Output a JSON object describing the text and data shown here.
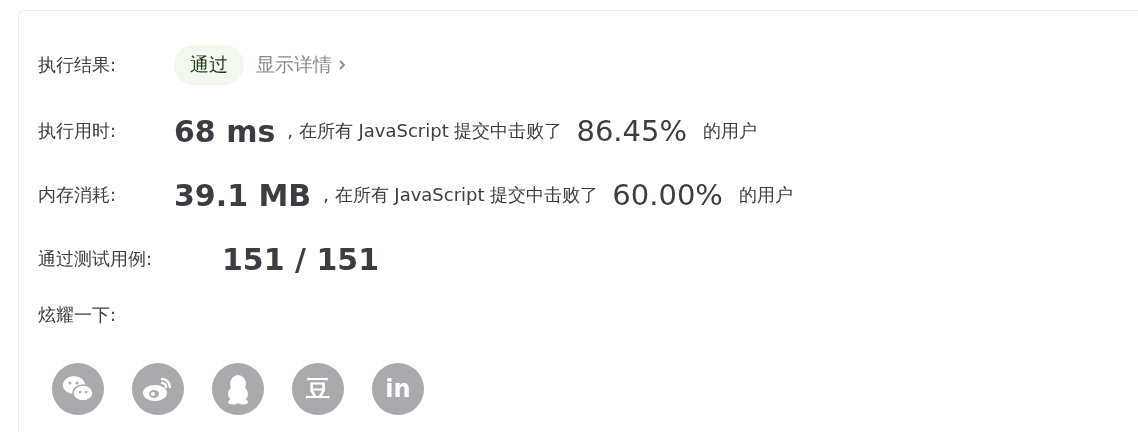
{
  "result": {
    "label": "执行结果:",
    "status": "通过",
    "details_link": "显示详情"
  },
  "stats": [
    {
      "label": "执行用时:",
      "value": "68 ms",
      "text": ", 在所有 JavaScript 提交中击败了",
      "percent": "86.45%",
      "suffix": "的用户"
    },
    {
      "label": "内存消耗:",
      "value": "39.1 MB",
      "text": ", 在所有 JavaScript 提交中击败了",
      "percent": "60.00%",
      "suffix": "的用户"
    }
  ],
  "tests": {
    "label": "通过测试用例:",
    "value": "151 / 151"
  },
  "share": {
    "label": "炫耀一下:",
    "items": [
      {
        "kind": "wechat"
      },
      {
        "kind": "weibo"
      },
      {
        "kind": "qq"
      },
      {
        "kind": "douban",
        "glyph": "豆"
      },
      {
        "kind": "linkedin",
        "glyph": "in"
      }
    ]
  }
}
